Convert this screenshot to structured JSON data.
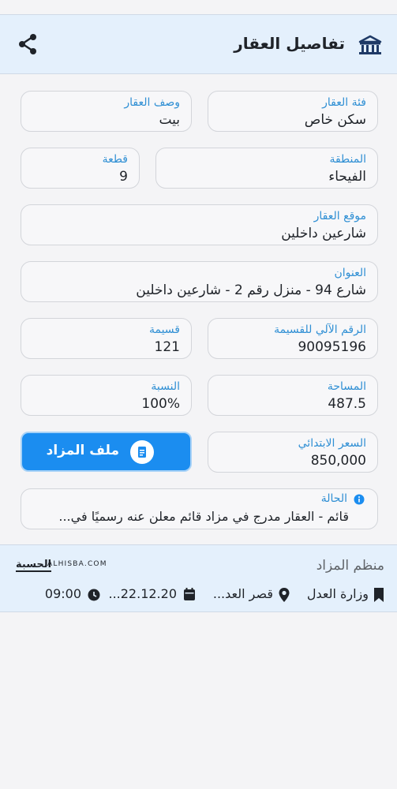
{
  "header": {
    "title": "تفاصيل العقار",
    "icon": "building-icon",
    "share_icon": "share-icon"
  },
  "fields": {
    "category": {
      "label": "فئة العقار",
      "value": "سكن خاص"
    },
    "description": {
      "label": "وصف العقار",
      "value": "بيت"
    },
    "area_region": {
      "label": "المنطقة",
      "value": "الفيحاء"
    },
    "block": {
      "label": "قطعة",
      "value": "9"
    },
    "location": {
      "label": "موقع العقار",
      "value": "شارعين داخلين"
    },
    "address": {
      "label": "العنوان",
      "value": "شارع 94 - منزل رقم 2 - شارعين داخلين"
    },
    "plot_auto_number": {
      "label": "الرقم الآلي للقسيمة",
      "value": "90095196"
    },
    "plot": {
      "label": "قسيمة",
      "value": "121"
    },
    "size": {
      "label": "المساحة",
      "value": "487.5"
    },
    "percentage": {
      "label": "النسبة",
      "value": "100%"
    },
    "starting_price": {
      "label": "السعر الابتدائي",
      "value": "850,000"
    }
  },
  "auction_button": {
    "label": "ملف المزاد",
    "icon": "document-icon"
  },
  "status": {
    "label": "الحالة",
    "text": "قائم - العقار مدرج في مزاد قائم معلن عنه رسميًا في...",
    "icon": "info-icon"
  },
  "organizer": {
    "title": "منظم المزاد",
    "logo_ar": "الحسبة",
    "logo_en": "ALHISBA.COM",
    "ministry": "وزارة العدل",
    "place": "قصر العد...",
    "date": "22.12.20...",
    "time": "09:00"
  },
  "colors": {
    "accent": "#2f8fd4",
    "button": "#1b8df0",
    "header_bg": "#e4f0fc"
  }
}
